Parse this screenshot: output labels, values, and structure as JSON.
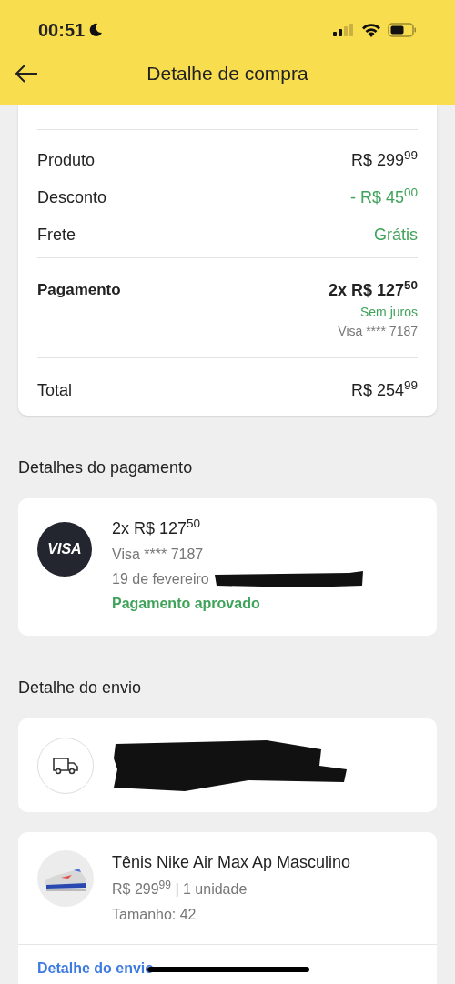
{
  "status_bar": {
    "time": "00:51"
  },
  "header": {
    "title": "Detalhe de compra"
  },
  "summary": {
    "rows": [
      {
        "label": "Produto",
        "value": "R$ 299$^{99}$",
        "kind": "plain"
      },
      {
        "label": "Desconto",
        "value": "- R$ 45$^{00}$",
        "kind": "positive"
      },
      {
        "label": "Frete",
        "value": "Grátis",
        "kind": "positive"
      }
    ],
    "payment": {
      "label": "Pagamento",
      "value": "2x R$ 127$^{50}$",
      "note": "Sem juros",
      "card": "Visa **** 7187"
    },
    "total": {
      "label": "Total",
      "value": "R$ 254$^{99}$"
    }
  },
  "payment_details": {
    "title": "Detalhes do pagamento",
    "logo": "VISA",
    "amount": "2x R$ 127$^{50}$",
    "card": "Visa **** 7187",
    "date": "19 de fevereiro",
    "status": "Pagamento aprovado"
  },
  "shipping": {
    "title": "Detalhe do envio"
  },
  "product": {
    "name": "Tênis Nike Air Max Ap Masculino",
    "price": "R$ 299$^{99}$ | 1 unidade",
    "size": "Tamanho: 42",
    "link": "Detalhe do envio"
  }
}
